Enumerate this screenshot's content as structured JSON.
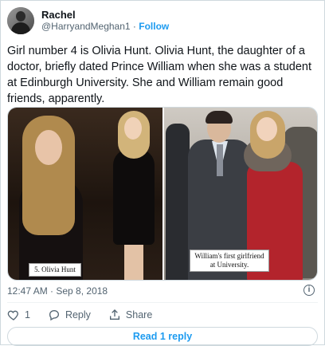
{
  "author": {
    "display_name": "Rachel",
    "handle": "@HarryandMeghan1",
    "separator": "·",
    "follow_label": "Follow"
  },
  "tweet": {
    "text": "Girl number 4 is Olivia Hunt. Olivia Hunt, the daughter of a doctor, briefly dated Prince William when she was a student at Edinburgh University. She and William remain good friends, apparently.",
    "timestamp": "12:47 AM · Sep 8, 2018"
  },
  "media": {
    "left_caption": "5. Olivia Hunt",
    "right_caption": "William's first girlfriend at University."
  },
  "actions": {
    "like_count": "1",
    "reply_label": "Reply",
    "share_label": "Share"
  },
  "replies_button": "Read 1 reply",
  "icons": {
    "info": "info-icon",
    "heart": "heart-icon",
    "reply": "reply-icon",
    "share": "share-icon"
  }
}
